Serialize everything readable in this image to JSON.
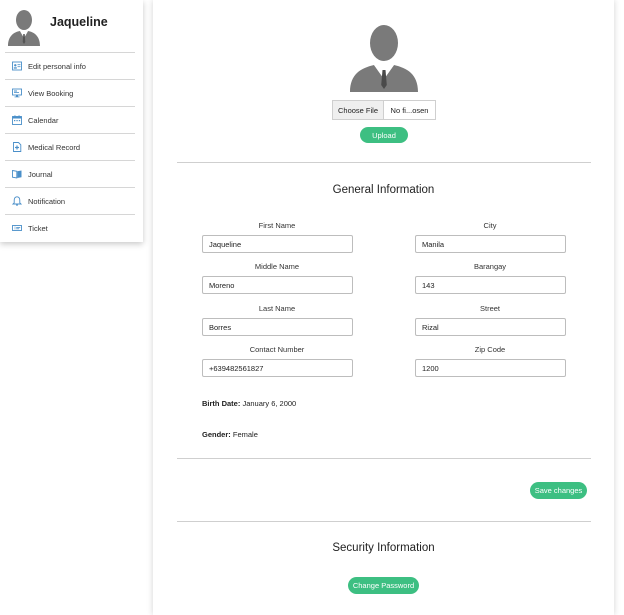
{
  "sidebar": {
    "user_name": "Jaqueline",
    "items": [
      {
        "label": "Edit personal info",
        "icon": "id-card-icon"
      },
      {
        "label": "View Booking",
        "icon": "monitor-icon"
      },
      {
        "label": "Calendar",
        "icon": "calendar-icon"
      },
      {
        "label": "Medical Record",
        "icon": "medical-record-icon"
      },
      {
        "label": "Journal",
        "icon": "journal-icon"
      },
      {
        "label": "Notification",
        "icon": "bell-icon"
      },
      {
        "label": "Ticket",
        "icon": "ticket-icon"
      }
    ]
  },
  "profile": {
    "choose_file_label": "Choose File",
    "file_name": "No fi...osen",
    "upload_label": "Upload"
  },
  "general": {
    "title": "General Information",
    "first_name_label": "First Name",
    "first_name": "Jaqueline",
    "middle_name_label": "Middle Name",
    "middle_name": "Moreno",
    "last_name_label": "Last Name",
    "last_name": "Borres",
    "contact_label": "Contact Number",
    "contact": "+639482561827",
    "city_label": "City",
    "city": "Manila",
    "barangay_label": "Barangay",
    "barangay": "143",
    "street_label": "Street",
    "street": "Rizal",
    "zip_label": "Zip Code",
    "zip": "1200",
    "birth_date_label": "Birth Date:",
    "birth_date": "January 6, 2000",
    "gender_label": "Gender:",
    "gender": "Female",
    "save_label": "Save changes"
  },
  "security": {
    "title": "Security Information",
    "change_password_label": "Change Password"
  },
  "colors": {
    "accent": "#3dbf82",
    "icon_blue": "#4a8fc9",
    "avatar_gray": "#7a7a7a"
  }
}
